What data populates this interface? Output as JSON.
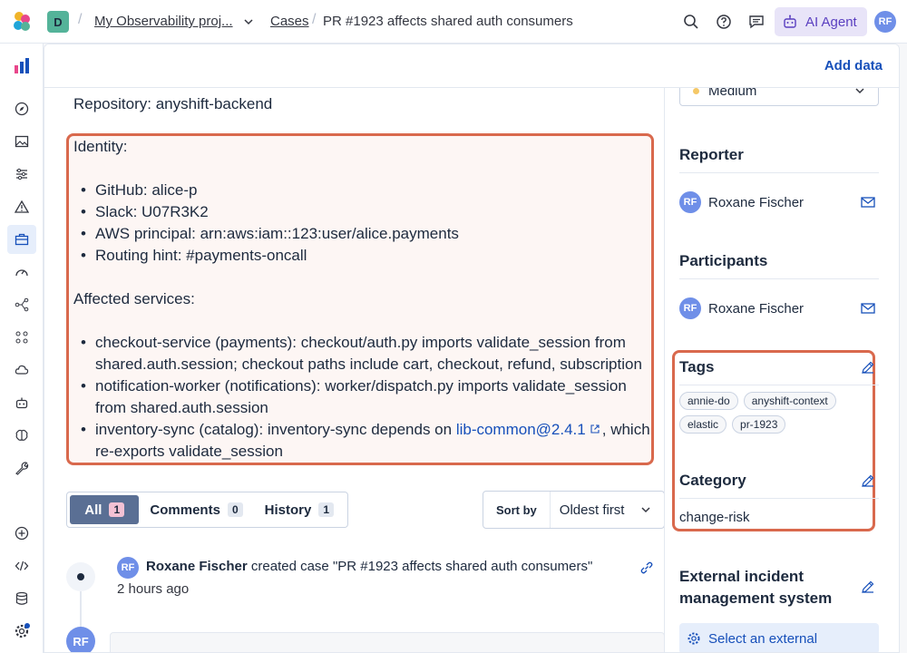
{
  "header": {
    "space_initial": "D",
    "breadcrumbs": [
      "My Observability proj...",
      "Cases",
      "PR #1923 affects shared auth consumers"
    ],
    "ai_agent_label": "AI Agent",
    "user_initials": "RF"
  },
  "panel": {
    "add_data_label": "Add data"
  },
  "description": {
    "partial_line": "...",
    "repository_line": "Repository: anyshift-backend",
    "identity_heading": "Identity:",
    "identity_items": [
      "GitHub: alice-p",
      "Slack: U07R3K2",
      "AWS principal: arn:aws:iam::123:user/alice.payments",
      "Routing hint: #payments-oncall"
    ],
    "affected_heading": "Affected services:",
    "affected_items": [
      "checkout-service (payments): checkout/auth.py imports validate_session from shared.auth.session; checkout paths include cart, checkout, refund, subscription",
      "notification-worker (notifications): worker/dispatch.py imports validate_session from shared.auth.session"
    ],
    "affected_last_prefix": "inventory-sync (catalog): inventory-sync depends on ",
    "affected_last_link": "lib-common@2.4.1",
    "affected_last_suffix": ", which re-exports validate_session"
  },
  "tabs": [
    {
      "label": "All",
      "count": "1"
    },
    {
      "label": "Comments",
      "count": "0"
    },
    {
      "label": "History",
      "count": "1"
    }
  ],
  "sort": {
    "label": "Sort by",
    "value": "Oldest first"
  },
  "activity": {
    "user_initials": "RF",
    "user": "Roxane Fischer",
    "action": " created case \"PR #1923 affects shared auth consumers\"",
    "time": "2 hours ago"
  },
  "sidebar_right": {
    "severity": "Medium",
    "reporter_title": "Reporter",
    "reporter_initials": "RF",
    "reporter_name": "Roxane Fischer",
    "participants_title": "Participants",
    "participant_initials": "RF",
    "participant_name": "Roxane Fischer",
    "tags_title": "Tags",
    "tags": [
      "annie-do",
      "anyshift-context",
      "elastic",
      "pr-1923"
    ],
    "category_title": "Category",
    "category_value": "change-risk",
    "external_title": "External incident management system",
    "external_button": "Select an external"
  },
  "colors": {
    "highlight": "#d9694d",
    "link": "#1750ba",
    "ai_agent": "#5a3fc0"
  }
}
